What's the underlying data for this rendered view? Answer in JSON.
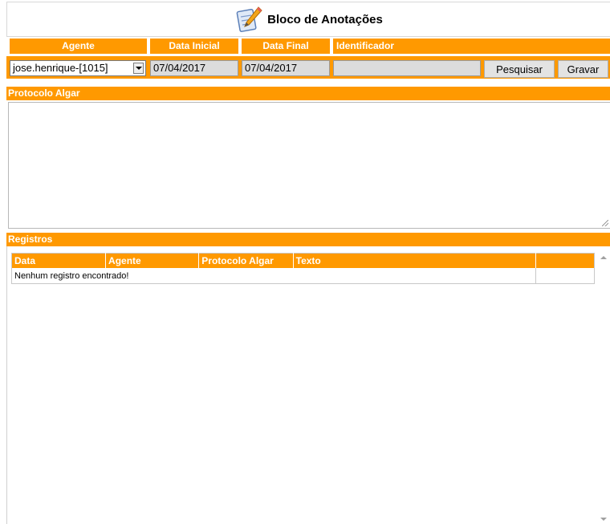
{
  "header": {
    "title": "Bloco de Anotações",
    "icon": "notepad-pencil-icon"
  },
  "filters": {
    "agent_label": "Agente",
    "start_date_label": "Data Inicial",
    "end_date_label": "Data Final",
    "identifier_label": "Identificador",
    "agent_value": "jose.henrique-[1015]",
    "start_date_value": "07/04/2017",
    "end_date_value": "07/04/2017",
    "identifier_value": "",
    "search_button": "Pesquisar",
    "save_button": "Gravar"
  },
  "protocol": {
    "label": "Protocolo Algar",
    "value": ""
  },
  "records": {
    "label": "Registros",
    "columns": [
      "Data",
      "Agente",
      "Protocolo Algar",
      "Texto",
      ""
    ],
    "empty_message": "Nenhum registro encontrado!"
  },
  "colors": {
    "accent": "#ff9900"
  }
}
